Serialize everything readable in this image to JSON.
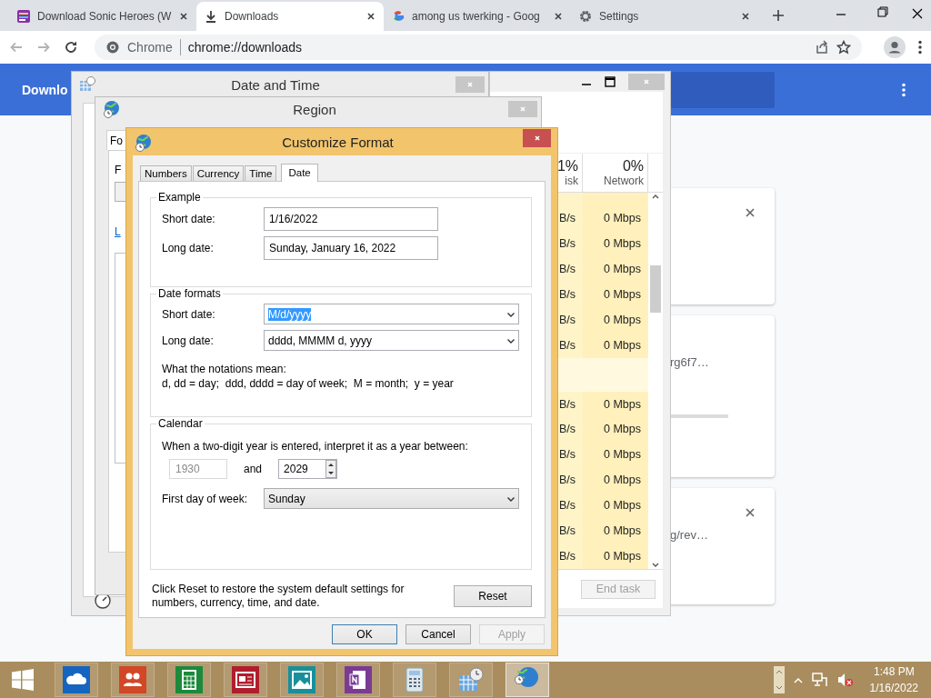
{
  "browser": {
    "tabs": [
      {
        "title": "Download Sonic Heroes (W",
        "kind": "site",
        "selected": false
      },
      {
        "title": "Downloads",
        "kind": "download",
        "selected": true
      },
      {
        "title": "among us twerking - Goog",
        "kind": "google",
        "selected": false
      },
      {
        "title": "Settings",
        "kind": "gear",
        "selected": false
      }
    ],
    "omnibox": {
      "site": "Chrome",
      "url": "chrome://downloads"
    },
    "page": {
      "header_title": "Downlo",
      "cards": [
        {
          "closable": true
        },
        {
          "closable": false,
          "url": "rg6f7…"
        },
        {
          "closable": true,
          "url": "g/rev…"
        }
      ]
    }
  },
  "task_manager": {
    "columns": [
      {
        "percent": "1%",
        "name": "isk"
      },
      {
        "percent": "0%",
        "name": "Network"
      }
    ],
    "rows": [
      {
        "kind": "process",
        "disk": "B/s",
        "network": "0 Mbps"
      },
      {
        "kind": "process",
        "disk": "B/s",
        "network": "0 Mbps"
      },
      {
        "kind": "process",
        "disk": "B/s",
        "network": "0 Mbps"
      },
      {
        "kind": "process",
        "disk": "B/s",
        "network": "0 Mbps"
      },
      {
        "kind": "process",
        "disk": "B/s",
        "network": "0 Mbps"
      },
      {
        "kind": "process",
        "disk": "B/s",
        "network": "0 Mbps"
      },
      {
        "kind": "group"
      },
      {
        "kind": "process",
        "disk": "B/s",
        "network": "0 Mbps"
      },
      {
        "kind": "process",
        "disk": "B/s",
        "network": "0 Mbps"
      },
      {
        "kind": "process",
        "disk": "B/s",
        "network": "0 Mbps"
      },
      {
        "kind": "process",
        "disk": "B/s",
        "network": "0 Mbps"
      },
      {
        "kind": "process",
        "disk": "B/s",
        "network": "0 Mbps"
      },
      {
        "kind": "process",
        "disk": "B/s",
        "network": "0 Mbps"
      },
      {
        "kind": "process",
        "disk": "B/s",
        "network": "0 Mbps"
      }
    ],
    "end_task": {
      "label": "End task",
      "disabled": true
    }
  },
  "date_and_time": {
    "title": "Date and Time"
  },
  "region": {
    "title": "Region",
    "tab": "Fo",
    "label": "F",
    "link": "L"
  },
  "customize_format": {
    "title": "Customize Format",
    "tabs": [
      {
        "label": "Numbers",
        "selected": false
      },
      {
        "label": "Currency",
        "selected": false
      },
      {
        "label": "Time",
        "selected": false
      },
      {
        "label": "Date",
        "selected": true
      }
    ],
    "example": {
      "legend": "Example",
      "rows": [
        {
          "label": "Short date:",
          "value": "1/16/2022"
        },
        {
          "label": "Long date:",
          "value": "Sunday, January 16, 2022"
        }
      ]
    },
    "formats": {
      "legend": "Date formats",
      "rows": [
        {
          "label": "Short date:",
          "value": "M/d/yyyy",
          "text_selected": true
        },
        {
          "label": "Long date:",
          "value": "dddd, MMMM d, yyyy",
          "text_selected": false
        }
      ],
      "note_title": "What the notations mean:",
      "note": "d, dd = day;  ddd, dddd = day of week;  M = month;  y = year"
    },
    "calendar": {
      "legend": "Calendar",
      "prompt": "When a two-digit year is entered, interpret it as a year between:",
      "from_year": {
        "value": "1930",
        "disabled": true
      },
      "and": "and",
      "to_year": "2029",
      "first_day_label": "First day of week:",
      "first_day": "Sunday"
    },
    "reset_note": "Click Reset to restore the system default settings for numbers, currency, time, and date.",
    "reset": "Reset",
    "buttons": [
      {
        "label": "OK",
        "default": true,
        "disabled": false
      },
      {
        "label": "Cancel",
        "default": false,
        "disabled": false
      },
      {
        "label": "Apply",
        "default": false,
        "disabled": true
      }
    ]
  },
  "taskbar": {
    "apps": [
      {
        "kind": "cloud",
        "selected": false
      },
      {
        "kind": "people",
        "selected": false
      },
      {
        "kind": "calculator",
        "selected": false
      },
      {
        "kind": "news",
        "selected": false
      },
      {
        "kind": "photos",
        "selected": false
      },
      {
        "kind": "notebook",
        "selected": false
      },
      {
        "kind": "calc",
        "selected": false
      },
      {
        "kind": "datetime",
        "selected": false
      },
      {
        "kind": "region",
        "selected": true
      }
    ],
    "clock": {
      "time": "1:48 PM",
      "date": "1/16/2022"
    }
  }
}
